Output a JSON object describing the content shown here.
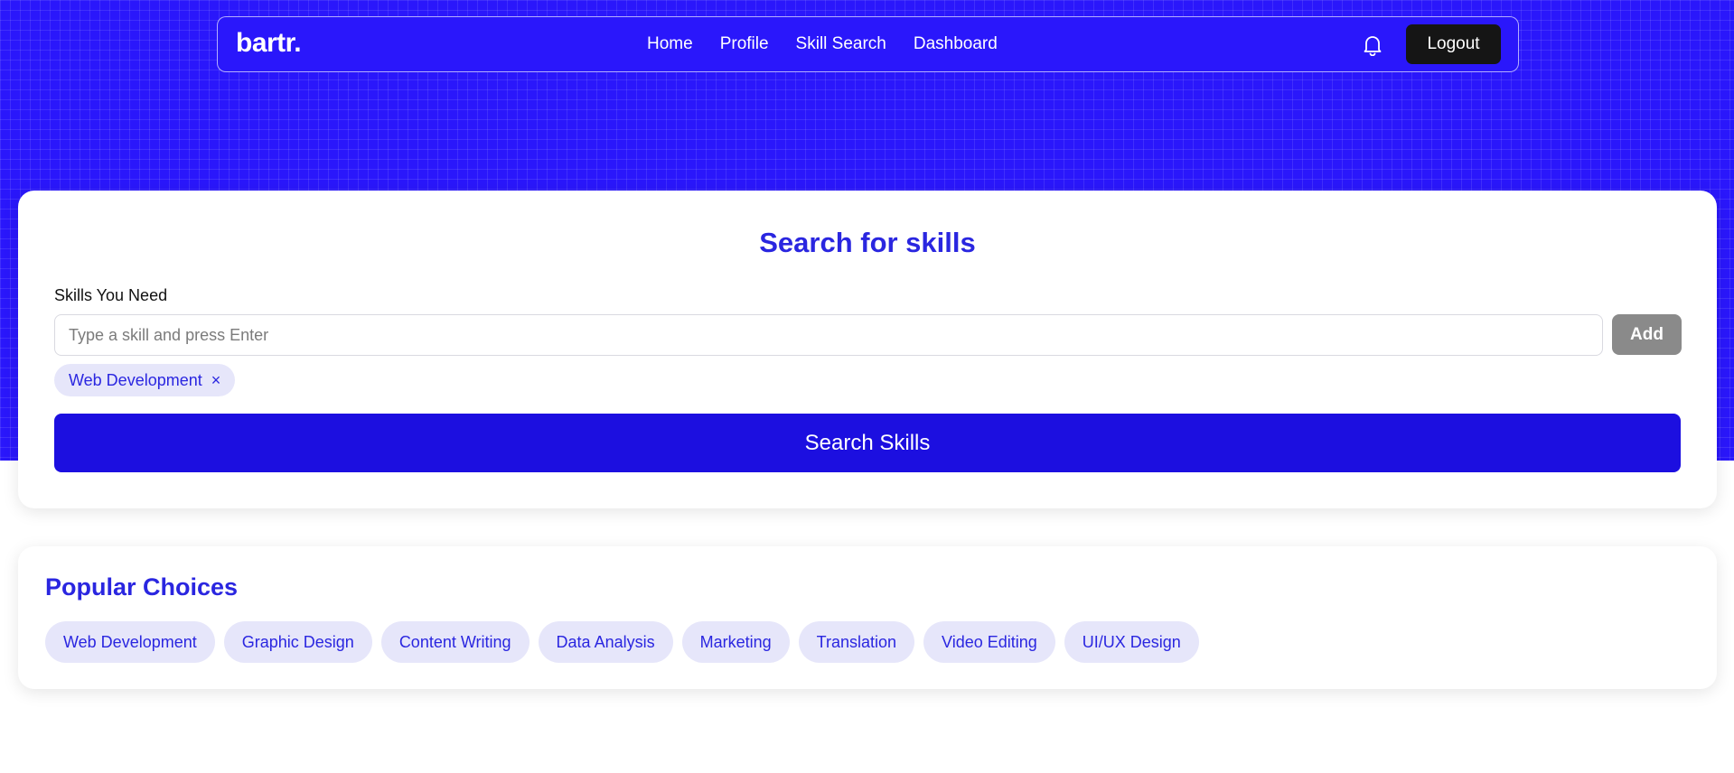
{
  "brand": {
    "logo": "bartr."
  },
  "nav": {
    "links": [
      "Home",
      "Profile",
      "Skill Search",
      "Dashboard"
    ],
    "notification_icon": "bell-icon",
    "logout_label": "Logout"
  },
  "search": {
    "title": "Search for skills",
    "field_label": "Skills You Need",
    "placeholder": "Type a skill and press Enter",
    "value": "",
    "add_label": "Add",
    "selected_skills": [
      "Web Development"
    ],
    "remove_glyph": "×",
    "submit_label": "Search Skills"
  },
  "popular": {
    "title": "Popular Choices",
    "items": [
      "Web Development",
      "Graphic Design",
      "Content Writing",
      "Data Analysis",
      "Marketing",
      "Translation",
      "Video Editing",
      "UI/UX Design"
    ]
  },
  "colors": {
    "hero": "#2a17fb",
    "accent_text": "#2a26e0",
    "primary_button": "#1c0fe0",
    "chip_bg": "#e6e6fa",
    "logout_bg": "#151515",
    "add_button": "#8a8a8a"
  }
}
